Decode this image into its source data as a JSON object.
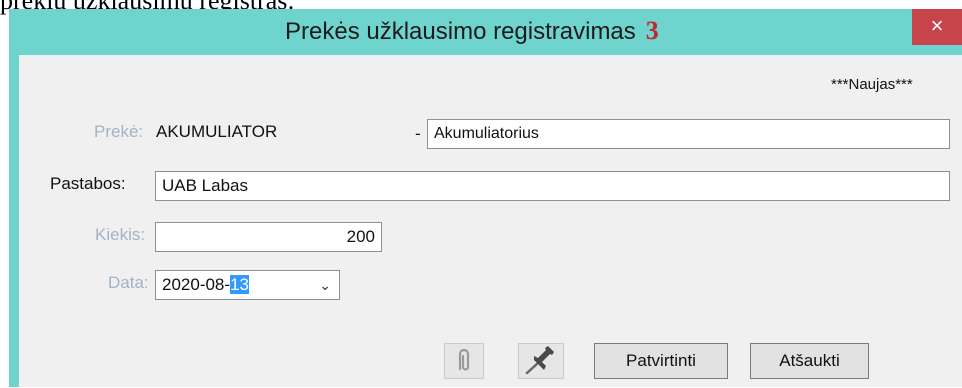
{
  "page_text": "prekių užklausimų registras:",
  "window": {
    "title": "Prekės užklausimo registravimas",
    "title_number": "3",
    "close_glyph": "×"
  },
  "status": "***Naujas***",
  "form": {
    "preke": {
      "label": "Prekė:",
      "code": "AKUMULIATOR",
      "separator": "-",
      "name": "Akumuliatorius"
    },
    "pastabos": {
      "label": "Pastabos:",
      "value": "UAB Labas"
    },
    "kiekis": {
      "label": "Kiekis:",
      "value": "200"
    },
    "data": {
      "label": "Data:",
      "value_prefix": "2020-08-",
      "value_selected": "13"
    }
  },
  "buttons": {
    "confirm_label": "Patvirtinti",
    "cancel_label": "Atšaukti"
  },
  "icons": {
    "attach": "paperclip-icon",
    "pin": "pin-icon"
  },
  "colors": {
    "title_bar": "#70d4ce",
    "close": "#c7444a",
    "selection": "#3399ff",
    "title_number": "#c0282d"
  }
}
